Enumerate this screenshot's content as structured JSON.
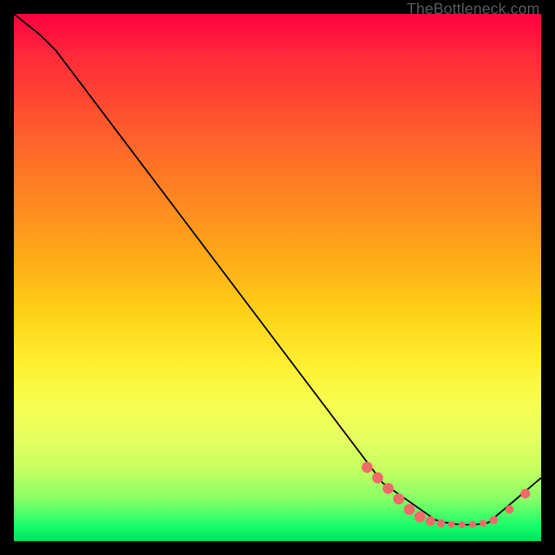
{
  "watermark": "TheBottleneck.com",
  "chart_data": {
    "type": "line",
    "title": "",
    "xlabel": "",
    "ylabel": "",
    "xlim": [
      0,
      100
    ],
    "ylim": [
      0,
      100
    ],
    "series": [
      {
        "name": "curve",
        "x": [
          0,
          5,
          8,
          70,
          80,
          82,
          84,
          86,
          88,
          90,
          100
        ],
        "values": [
          100,
          96,
          93,
          11,
          4,
          3.5,
          3.2,
          3.1,
          3.2,
          3.5,
          12
        ]
      }
    ],
    "markers": {
      "comment": "pink dotted highlight along trough and up-slope",
      "x": [
        67,
        69,
        71,
        73,
        75,
        77,
        79,
        81,
        83,
        85,
        87,
        89,
        91,
        94,
        97
      ],
      "values": [
        14,
        12,
        10,
        8,
        6,
        4.6,
        3.8,
        3.4,
        3.2,
        3.1,
        3.2,
        3.4,
        4,
        6,
        9
      ],
      "color": "#f06a6a",
      "size": [
        8,
        8,
        8,
        8,
        8,
        8,
        7,
        6,
        5,
        5,
        5,
        5,
        6,
        6,
        7
      ]
    },
    "line_color": "#000000",
    "grid": false
  }
}
